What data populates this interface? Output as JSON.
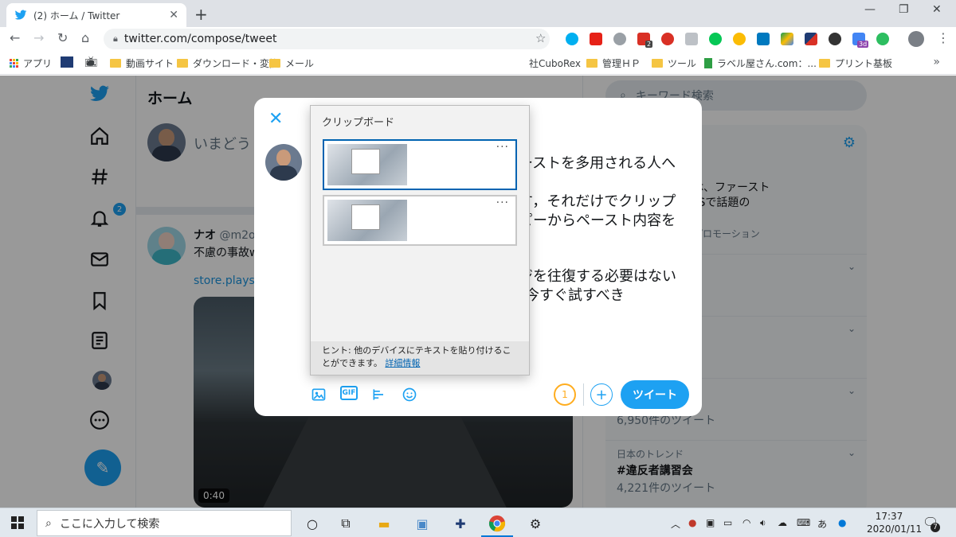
{
  "browser": {
    "tab_title": "(2) ホーム / Twitter",
    "url": "twitter.com/compose/tweet",
    "bookmarks": [
      {
        "label": "アプリ"
      },
      {
        "label": "動画サイト"
      },
      {
        "label": "ダウンロード・変換"
      },
      {
        "label": "メール"
      },
      {
        "label": "社CuboRex"
      },
      {
        "label": "管理ＨＰ"
      },
      {
        "label": "ツール"
      },
      {
        "label": "ラベル屋さん.com：..."
      },
      {
        "label": "プリント基板"
      }
    ],
    "ext_badges": {
      "mail": "2",
      "calendar": "3d"
    }
  },
  "twitter": {
    "home_title": "ホーム",
    "compose_placeholder": "いまどうし",
    "notification_count": "2",
    "tweet": {
      "name": "ナオ",
      "handle": "@m2o_",
      "text": "不慮の事故w",
      "link": "store.playsta",
      "video_time": "0:40"
    },
    "search_placeholder": "キーワード検索",
    "trends_title": "ンド",
    "promo_text": "O日！この三連休、ファースト出に残そう。SNSで話題のラボ中！",
    "promo_line1": "O日！この三連休、ファースト",
    "promo_line2": "出に残そう。SNSで話題の",
    "promo_line3": "ラボ中！",
    "promo_by": "SAHIBEERによるプロモーション",
    "trends": [
      {
        "meta": "",
        "name": "",
        "count": "ツイート"
      },
      {
        "meta": "",
        "name": "",
        "count": "ツイート"
      },
      {
        "meta": "",
        "name": "",
        "count": "6,950件のツイート"
      },
      {
        "meta": "日本のトレンド",
        "name": "#違反者講習会",
        "count": "4,221件のツイート"
      }
    ]
  },
  "compose_modal": {
    "text_lines": [
      "ーストを多用される人へ",
      "す，それだけでクリップ",
      "ピーからペースト内容を",
      "ジを往復する必要はない",
      "今すぐ試すべき"
    ],
    "char_counter": "1",
    "tweet_button": "ツイート"
  },
  "clipboard": {
    "title": "クリップボード",
    "hint": "ヒント: 他のデバイスにテキストを貼り付けることができます。",
    "hint_link": "詳細情報",
    "more_label": "···"
  },
  "taskbar": {
    "search_placeholder": "ここに入力して検索",
    "time": "17:37",
    "date": "2020/01/11",
    "ime": "あ",
    "notification_count": "7"
  },
  "colors": {
    "twitter_blue": "#1da1f2",
    "counter_orange": "#ffad1f",
    "clipboard_select": "#0063b1"
  }
}
